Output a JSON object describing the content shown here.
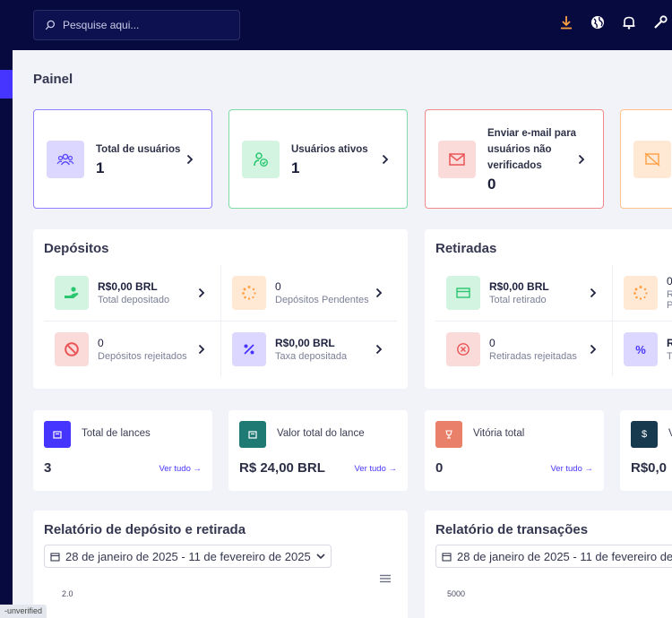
{
  "search": {
    "placeholder": "Pesquise aqui..."
  },
  "topbar_icons": [
    "download-icon",
    "globe-icon",
    "bell-icon",
    "wrench-icon"
  ],
  "page_title": "Painel",
  "widgets": [
    {
      "label": "Total de usuários",
      "value": "1",
      "icon": "users-icon",
      "color": "#6f5cff"
    },
    {
      "label": "Usuários ativos",
      "value": "1",
      "icon": "user-check-icon",
      "color": "#28c76f"
    },
    {
      "label": "Enviar e-mail para usuários não verificados",
      "value": "0",
      "icon": "envelope-icon",
      "color": "#ea5455"
    },
    {
      "label": "",
      "value": "",
      "icon": "mobile-off-icon",
      "color": "#ff9f43"
    }
  ],
  "deposits": {
    "title": "Depósitos",
    "items": [
      {
        "value": "R$0,00 BRL",
        "label": "Total depositado",
        "icon": "hand-money-icon"
      },
      {
        "value": "0",
        "label": "Depósitos Pendentes",
        "icon": "spinner-icon"
      },
      {
        "value": "0",
        "label": "Depósitos rejeitados",
        "icon": "ban-icon"
      },
      {
        "value": "R$0,00 BRL",
        "label": "Taxa depositada",
        "icon": "percent-icon"
      }
    ]
  },
  "withdrawals": {
    "title": "Retiradas",
    "items": [
      {
        "value": "R$0,00 BRL",
        "label": "Total retirado",
        "icon": "card-icon"
      },
      {
        "value": "0",
        "label": "R P",
        "icon": "spinner-icon"
      },
      {
        "value": "0",
        "label": "Retiradas rejeitadas",
        "icon": "times-circle-icon"
      },
      {
        "value": "R",
        "label": "T",
        "icon": "percent-icon"
      }
    ]
  },
  "stats": [
    {
      "label": "Total de lances",
      "value": "3",
      "link": "Ver tudo",
      "icon": "gavel-icon",
      "color": "#4634ff"
    },
    {
      "label": "Valor total do lance",
      "value": "R$ 24,00 BRL",
      "link": "Ver tudo",
      "icon": "gavel-icon",
      "color": "#1e7a73"
    },
    {
      "label": "Vitória total",
      "value": "0",
      "link": "Ver tudo",
      "icon": "trophy-icon",
      "color": "#e8806a"
    },
    {
      "label": "V",
      "value": "R$0,0",
      "link": "",
      "icon": "dollar-icon",
      "color": "#183a4f"
    }
  ],
  "reports": [
    {
      "title": "Relatório de depósito e retirada",
      "date_range": "28 de janeiro de 2025 - 11 de fevereiro de 2025",
      "y_tick": "2.0"
    },
    {
      "title": "Relatório de transações",
      "date_range": "28 de janeiro de 2025 - 11 de fevereiro de 2025",
      "y_tick": "5000"
    }
  ],
  "footer_badge": "-unverified"
}
